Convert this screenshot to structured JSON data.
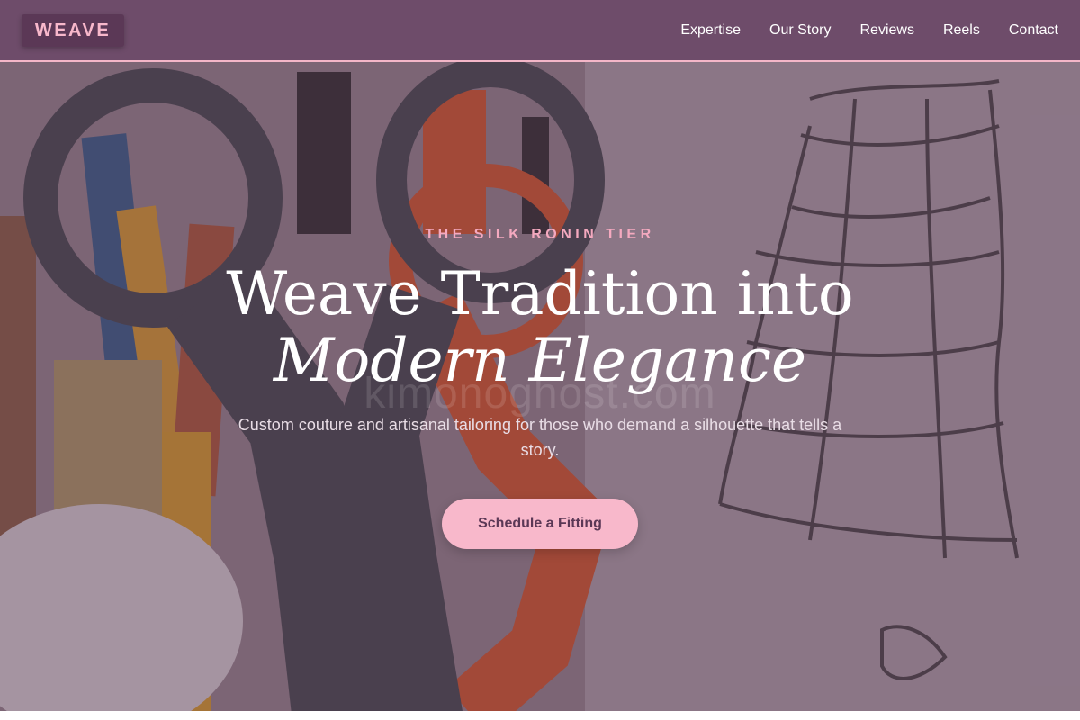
{
  "nav": {
    "logo": "WEAVE",
    "links": [
      "Expertise",
      "Our Story",
      "Reviews",
      "Reels",
      "Contact"
    ]
  },
  "hero": {
    "eyebrow": "THE SILK RONIN TIER",
    "headline_line1": "Weave Tradition into",
    "headline_line2": "Modern Elegance",
    "watermark": "kimonoghost.com",
    "subtitle": "Custom couture and artisanal tailoring for those who demand a silhouette that tells a story.",
    "cta_label": "Schedule a Fitting"
  },
  "colors": {
    "nav_bg": "#6e4c6a",
    "accent_pink": "#f8b8cb",
    "nav_border": "#f4b6c8",
    "logo_bg": "#5b3856"
  }
}
